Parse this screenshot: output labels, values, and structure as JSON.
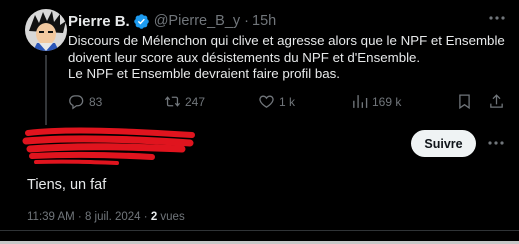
{
  "tweet": {
    "author_name": "Pierre B.",
    "handle": "@Pierre_B_y",
    "separator": "·",
    "time": "15h",
    "text_lines": [
      "Discours de Mélenchon qui clive et agresse alors que le NPF et Ensemble",
      "doivent leur score aux désistements du NPF et d'Ensemble.",
      "Le NPF et Ensemble devraient faire profil bas."
    ],
    "actions": {
      "replies": "83",
      "retweets": "247",
      "likes": "1 k",
      "views": "169 k"
    }
  },
  "reply": {
    "follow_label": "Suivre",
    "text": "Tiens, un faf",
    "timestamp": "11:39 AM · 8 juil. 2024 · ",
    "views_count": "2",
    "views_label": " vues"
  },
  "colors": {
    "background": "#000000",
    "text": "#e7e9ea",
    "muted": "#71767b",
    "verified": "#1d9bf0",
    "redaction": "#e0141e",
    "follow_bg": "#eff3f4"
  },
  "icons": {
    "verified": "verified-badge-icon",
    "more": "more-icon",
    "reply": "reply-icon",
    "retweet": "retweet-icon",
    "like": "heart-icon",
    "views": "views-icon",
    "bookmark": "bookmark-icon",
    "share": "share-icon"
  }
}
